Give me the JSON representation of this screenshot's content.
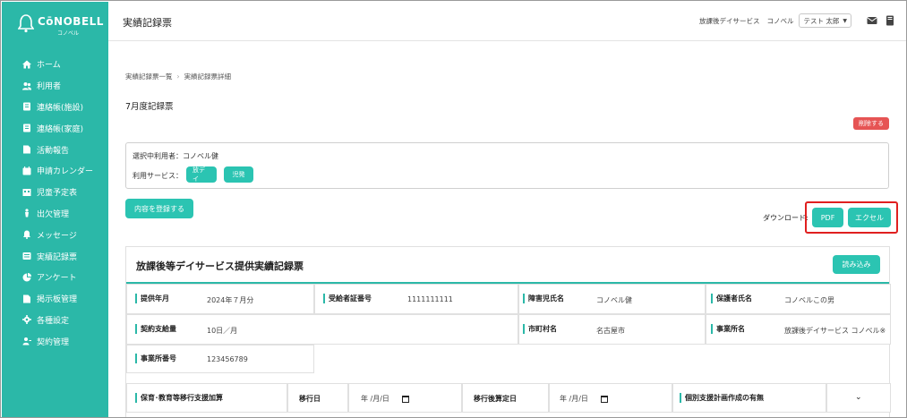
{
  "brand": {
    "name": "CōNOBELL",
    "sub": "コノベル"
  },
  "sidebar": {
    "items": [
      {
        "label": "ホーム",
        "icon": "home-icon"
      },
      {
        "label": "利用者",
        "icon": "users-icon"
      },
      {
        "label": "連絡帳(施設)",
        "icon": "notebook-icon"
      },
      {
        "label": "連絡帳(家庭)",
        "icon": "notebook-home-icon"
      },
      {
        "label": "活動報告",
        "icon": "report-icon"
      },
      {
        "label": "申請カレンダー",
        "icon": "calendar-icon"
      },
      {
        "label": "児童予定表",
        "icon": "schedule-icon"
      },
      {
        "label": "出欠管理",
        "icon": "attendance-icon"
      },
      {
        "label": "メッセージ",
        "icon": "bell-icon"
      },
      {
        "label": "実績記録票",
        "icon": "list-icon"
      },
      {
        "label": "アンケート",
        "icon": "pie-icon"
      },
      {
        "label": "掲示板管理",
        "icon": "board-icon"
      },
      {
        "label": "各種設定",
        "icon": "gear-icon"
      },
      {
        "label": "契約管理",
        "icon": "contract-icon"
      }
    ]
  },
  "header": {
    "title": "実績記録票",
    "service": "放課後デイサービス",
    "org": "コノベル",
    "user": "テスト 太郎"
  },
  "breadcrumb": {
    "parent": "実績記録票一覧",
    "current": "実績記録票詳細"
  },
  "record_title": "7月度記録票",
  "delete_label": "削除する",
  "selection": {
    "user_label": "選択中利用者：",
    "user_value": "コノベル健",
    "service_label": "利用サービス：",
    "services": [
      "放デイ",
      "児発"
    ]
  },
  "register_label": "内容を登録する",
  "download": {
    "label": "ダウンロード:",
    "pdf": "PDF",
    "excel": "エクセル"
  },
  "card": {
    "title": "放課後等デイサービス提供実績記録票",
    "load_label": "読み込み",
    "fields": {
      "provide_month": {
        "label": "提供年月",
        "value": "2024年７月分"
      },
      "recipient_no": {
        "label": "受給者証番号",
        "value": "1111111111"
      },
      "child_name": {
        "label": "障害児氏名",
        "value": "コノベル健"
      },
      "guardian_name": {
        "label": "保護者氏名",
        "value": "コノベルこの男"
      },
      "contract_amount": {
        "label": "契約支給量",
        "value": "10日／月"
      },
      "municipality": {
        "label": "市町村名",
        "value": "名古屋市"
      },
      "office_name": {
        "label": "事業所名",
        "value": "放課後デイサービス コノベル※"
      },
      "office_no": {
        "label": "事業所番号",
        "value": "123456789"
      }
    },
    "transition": {
      "label": "保育･教育等移行支援加算",
      "date_label": "移行日",
      "date_placeholder": "年 /月/日",
      "after_label": "移行後算定日",
      "after_placeholder": "年 /月/日",
      "plan_label": "個別支援計画作成の有無"
    }
  }
}
